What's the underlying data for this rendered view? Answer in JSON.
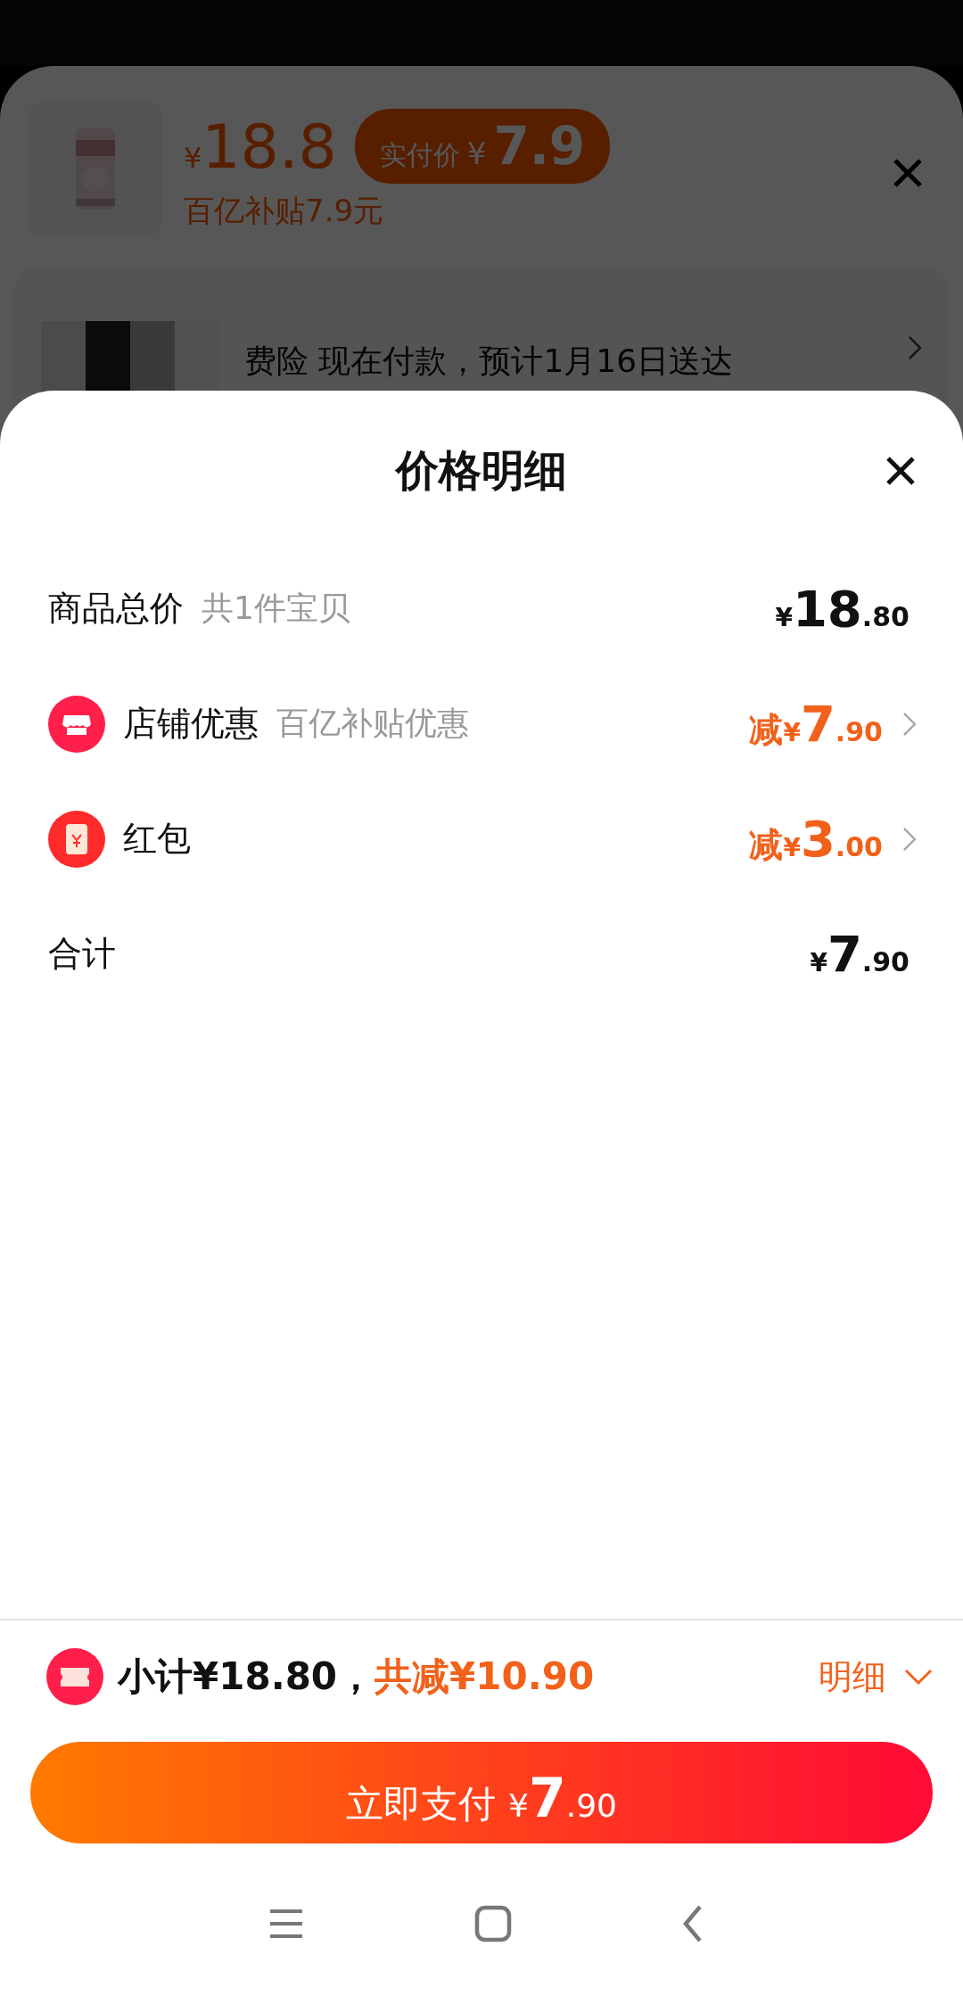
{
  "background": {
    "product": {
      "price": {
        "currency": "¥",
        "amount": "18.8"
      },
      "paid_badge": {
        "label": "实付价",
        "currency": "¥",
        "amount": "7.9"
      },
      "subsidy": "百亿补贴7.9元"
    },
    "delivery": "费险 现在付款，预计1月16日送达"
  },
  "sheet": {
    "title": "价格明细",
    "rows": [
      {
        "kind": "total",
        "label": "商品总价",
        "note": "共1件宝贝",
        "amount": {
          "currency": "¥",
          "whole": "18",
          "fraction": ".80"
        },
        "chevron": false
      },
      {
        "kind": "shop",
        "label": "店铺优惠",
        "note": "百亿补贴优惠",
        "amount": {
          "prefix": "减",
          "currency": "¥",
          "whole": "7",
          "fraction": ".90"
        },
        "chevron": true
      },
      {
        "kind": "redpacket",
        "label": "红包",
        "amount": {
          "prefix": "减",
          "currency": "¥",
          "whole": "3",
          "fraction": ".00"
        },
        "chevron": true
      },
      {
        "kind": "sum",
        "label": "合计",
        "amount": {
          "currency": "¥",
          "whole": "7",
          "fraction": ".90"
        },
        "chevron": false
      }
    ]
  },
  "footer": {
    "subtotal": "小计¥18.80，",
    "discount": "共减¥10.90",
    "details": "明细",
    "expanded": true,
    "pay_button": {
      "label": "立即支付",
      "currency": "¥",
      "whole": "7",
      "fraction": ".90"
    }
  }
}
